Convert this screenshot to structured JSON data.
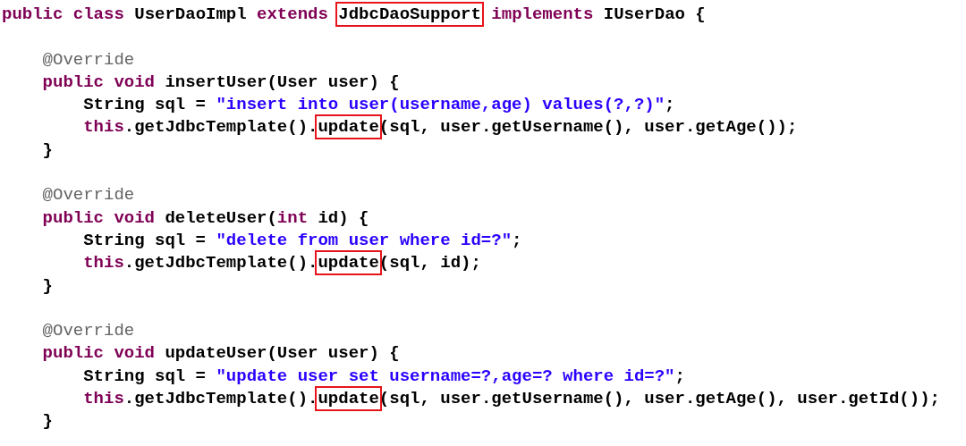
{
  "code": [
    {
      "tokens": [
        {
          "text": "public class",
          "kind": "keyword"
        },
        {
          "text": " UserDaoImpl ",
          "kind": "plain"
        },
        {
          "text": "extends ",
          "kind": "keyword"
        },
        {
          "text": "JdbcDaoSupport",
          "kind": "plain",
          "highlighted": true
        },
        {
          "text": " implements",
          "kind": "keyword"
        },
        {
          "text": " IUserDao {",
          "kind": "plain"
        }
      ],
      "children": [
        {
          "blank_before": true,
          "tokens": [
            {
              "text": "@Override",
              "kind": "annotation"
            }
          ]
        },
        {
          "tokens": [
            {
              "text": "public void",
              "kind": "keyword"
            },
            {
              "text": " insertUser(User user) {",
              "kind": "plain"
            }
          ],
          "children": [
            {
              "tokens": [
                {
                  "text": "String sql = ",
                  "kind": "plain"
                },
                {
                  "text": "\"insert into user(username,age) values(?,?)\"",
                  "kind": "string"
                },
                {
                  "text": ";",
                  "kind": "plain"
                }
              ]
            },
            {
              "tokens": [
                {
                  "text": "this",
                  "kind": "keyword"
                },
                {
                  "text": ".getJdbcTemplate().",
                  "kind": "plain"
                },
                {
                  "text": "update",
                  "kind": "plain",
                  "highlighted": true
                },
                {
                  "text": "(sql, user.getUsername(), user.getAge());",
                  "kind": "plain"
                }
              ]
            }
          ]
        },
        {
          "tokens": [
            {
              "text": "}",
              "kind": "plain"
            }
          ]
        },
        {
          "blank_before": true,
          "tokens": [
            {
              "text": "@Override",
              "kind": "annotation"
            }
          ]
        },
        {
          "tokens": [
            {
              "text": "public void",
              "kind": "keyword"
            },
            {
              "text": " deleteUser(",
              "kind": "plain"
            },
            {
              "text": "int",
              "kind": "keyword"
            },
            {
              "text": " id) {",
              "kind": "plain"
            }
          ],
          "children": [
            {
              "tokens": [
                {
                  "text": "String sql = ",
                  "kind": "plain"
                },
                {
                  "text": "\"delete from user where id=?\"",
                  "kind": "string"
                },
                {
                  "text": ";",
                  "kind": "plain"
                }
              ]
            },
            {
              "tokens": [
                {
                  "text": "this",
                  "kind": "keyword"
                },
                {
                  "text": ".getJdbcTemplate().",
                  "kind": "plain"
                },
                {
                  "text": "update",
                  "kind": "plain",
                  "highlighted": true
                },
                {
                  "text": "(sql, id);",
                  "kind": "plain"
                }
              ]
            }
          ]
        },
        {
          "tokens": [
            {
              "text": "}",
              "kind": "plain"
            }
          ]
        },
        {
          "blank_before": true,
          "tokens": [
            {
              "text": "@Override",
              "kind": "annotation"
            }
          ]
        },
        {
          "tokens": [
            {
              "text": "public void",
              "kind": "keyword"
            },
            {
              "text": " updateUser(User user) {",
              "kind": "plain"
            }
          ],
          "children": [
            {
              "tokens": [
                {
                  "text": "String sql = ",
                  "kind": "plain"
                },
                {
                  "text": "\"update user set username=?,age=? where id=?\"",
                  "kind": "string"
                },
                {
                  "text": ";",
                  "kind": "plain"
                }
              ]
            },
            {
              "tokens": [
                {
                  "text": "this",
                  "kind": "keyword"
                },
                {
                  "text": ".getJdbcTemplate().",
                  "kind": "plain"
                },
                {
                  "text": "update",
                  "kind": "plain",
                  "highlighted": true
                },
                {
                  "text": "(sql, user.getUsername(), user.getAge(), user.getId());",
                  "kind": "plain"
                }
              ]
            }
          ]
        },
        {
          "tokens": [
            {
              "text": "}",
              "kind": "plain"
            }
          ]
        }
      ]
    }
  ]
}
